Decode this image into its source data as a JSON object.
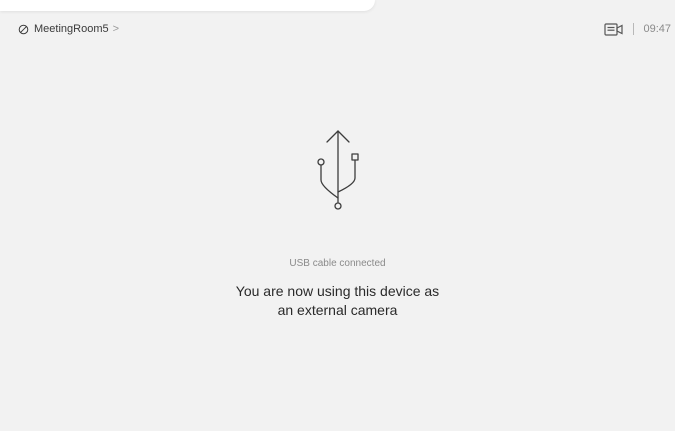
{
  "header": {
    "room_name": "MeetingRoom5",
    "room_chevron": ">",
    "time": "09:47",
    "room_icon": "status-circle-icon",
    "camera_icon": "camera-share-icon"
  },
  "main": {
    "icon": "usb-icon",
    "status_text": "USB cable connected",
    "message_line1": "You are now using this device as",
    "message_line2": "an external camera"
  }
}
